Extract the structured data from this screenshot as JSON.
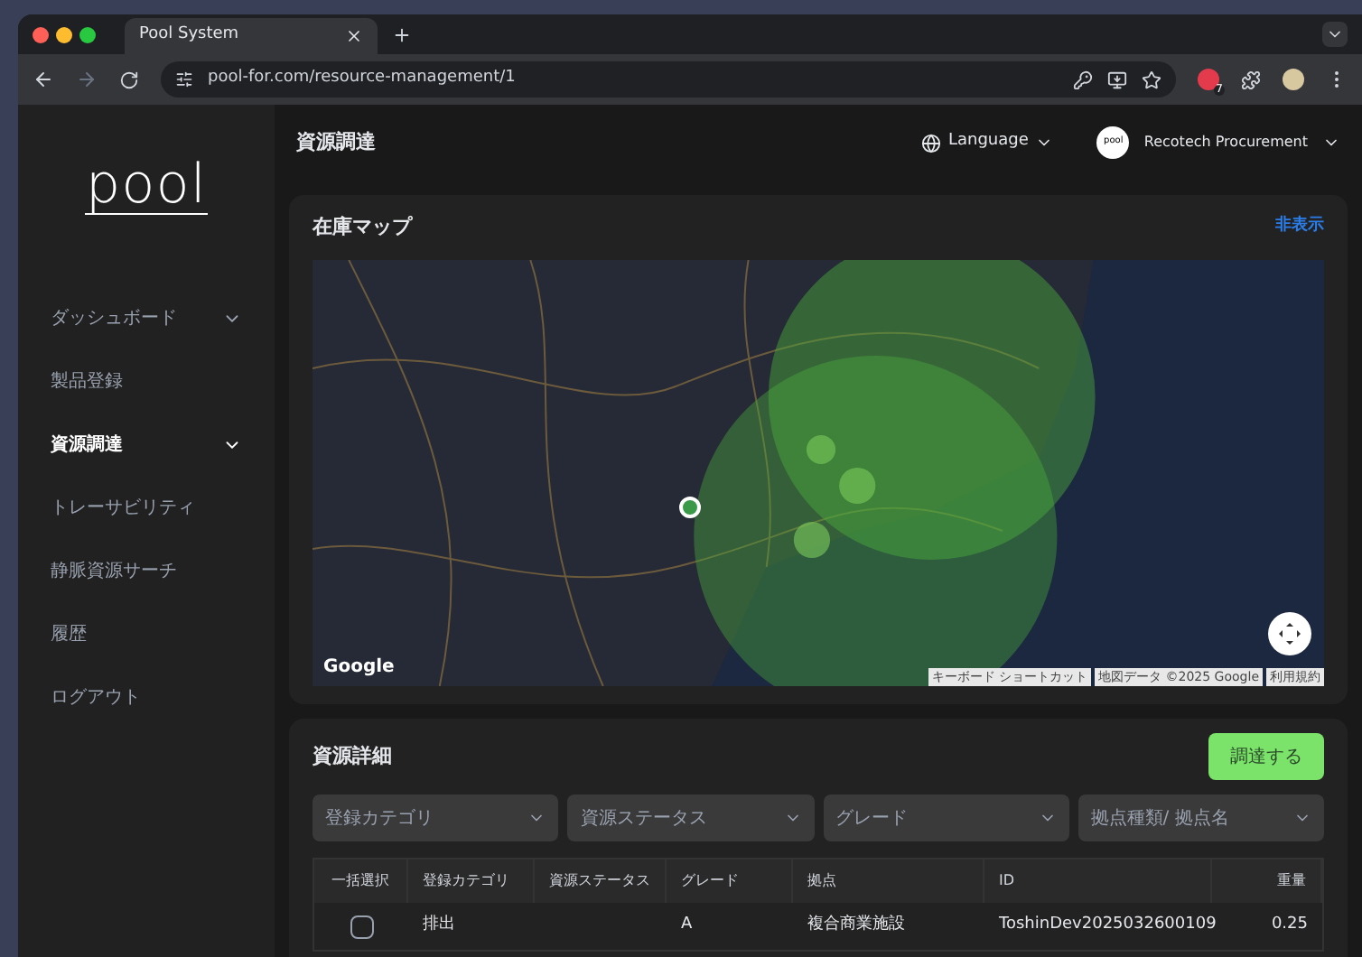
{
  "browser": {
    "tab_title": "Pool System",
    "url": "pool-for.com/resource-management/1",
    "extension_badge": "7"
  },
  "header": {
    "title": "資源調達",
    "language": "Language",
    "avatar_text": "pool",
    "user": "Recotech Procurement"
  },
  "sidebar": {
    "logo": "pool",
    "items": [
      {
        "label": "ダッシュボード",
        "selected": false,
        "expandable": true
      },
      {
        "label": "製品登録",
        "selected": false,
        "expandable": false
      },
      {
        "label": "資源調達",
        "selected": true,
        "expandable": true
      },
      {
        "label": "トレーサビリティ",
        "selected": false,
        "expandable": false
      },
      {
        "label": "静脈資源サーチ",
        "selected": false,
        "expandable": false
      },
      {
        "label": "履歴",
        "selected": false,
        "expandable": false
      },
      {
        "label": "ログアウト",
        "selected": false,
        "expandable": false
      }
    ]
  },
  "map_card": {
    "title": "在庫マップ",
    "hide_link": "非表示",
    "map": {
      "kind": "picture"
    },
    "logo": "Google",
    "attribution": [
      "キーボード ショートカット",
      "地図データ ©2025 Google",
      "利用規約"
    ]
  },
  "details": {
    "title": "資源詳細",
    "action": "調達する",
    "filters": [
      {
        "placeholder": "登録カテゴリ"
      },
      {
        "placeholder": "資源ステータス"
      },
      {
        "placeholder": "グレード"
      },
      {
        "placeholder": "拠点種類/ 拠点名"
      }
    ],
    "table": {
      "select_column": "一括選択",
      "columns": [
        "登録カテゴリ",
        "資源ステータス",
        "グレード",
        "拠点",
        "ID",
        "重量"
      ],
      "rows": [
        {
          "checked": false,
          "cells": [
            "排出",
            "",
            "A",
            "複合商業施設",
            "ToshinDev2025032600109",
            "0.25"
          ]
        }
      ]
    }
  }
}
